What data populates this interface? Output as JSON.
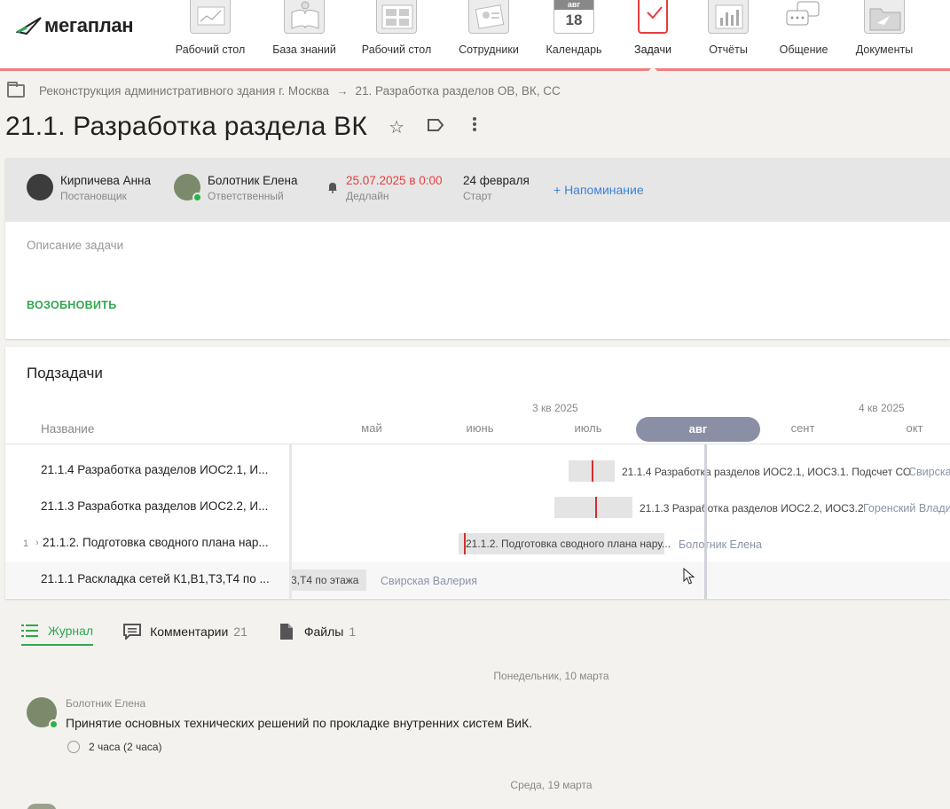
{
  "logo": {
    "text": "мегаплан"
  },
  "nav": [
    {
      "label": "Рабочий стол"
    },
    {
      "label": "База знаний"
    },
    {
      "label": "Рабочий стол"
    },
    {
      "label": "Сотрудники"
    },
    {
      "label": "Календарь",
      "month": "авг",
      "day": "18"
    },
    {
      "label": "Задачи"
    },
    {
      "label": "Отчёты"
    },
    {
      "label": "Общение"
    },
    {
      "label": "Документы"
    }
  ],
  "breadcrumb": {
    "parent": "Реконструкция административного здания г. Москва",
    "arrow": "→",
    "current": "21. Разработка разделов ОВ, ВК, СС"
  },
  "task": {
    "title": "21.1. Разработка раздела ВК",
    "setter": {
      "name": "Кирпичева Анна",
      "role": "Постановщик"
    },
    "responsible": {
      "name": "Болотник Елена",
      "role": "Ответственный"
    },
    "deadline": {
      "value": "25.07.2025 в 0:00",
      "label": "Дедлайн"
    },
    "start": {
      "value": "24 февраля",
      "label": "Старт"
    },
    "reminder": "+ Напоминание",
    "description_placeholder": "Описание задачи",
    "reopen": "ВОЗОБНОВИТЬ"
  },
  "subtasks": {
    "title": "Подзадачи",
    "column_name": "Название",
    "quarters": [
      "3 кв 2025",
      "4 кв 2025"
    ],
    "months": [
      "май",
      "июнь",
      "июль",
      "авг",
      "сент",
      "окт"
    ],
    "active_month": "авг",
    "rows": [
      {
        "name": "21.1.4 Разработка разделов ИОС2.1, И...",
        "bar_label": "21.1.4 Разработка разделов ИОС2.1, ИОС3.1. Подсчет СО",
        "owner": "Свирска"
      },
      {
        "name": "21.1.3 Разработка разделов ИОС2.2, И...",
        "bar_label": "21.1.3 Разработка разделов ИОС2.2, ИОС3.2",
        "owner": "Горенский Влади"
      },
      {
        "num": "1",
        "name": "21.1.2. Подготовка сводного плана нар...",
        "bar_label": "21.1.2. Подготовка сводного плана нару...",
        "owner": "Болотник Елена"
      },
      {
        "name": "21.1.1 Раскладка сетей К1,В1,Т3,Т4 по ...",
        "bar_label": "3,Т4 по этажа",
        "owner": "Свирская Валерия"
      }
    ]
  },
  "journal": {
    "tabs": [
      {
        "label": "Журнал",
        "count": ""
      },
      {
        "label": "Комментарии",
        "count": "21"
      },
      {
        "label": "Файлы",
        "count": "1"
      }
    ],
    "day1": "Понедельник, 10 марта",
    "entry": {
      "author": "Болотник Елена",
      "text": "Принятие основных технических решений по прокладке внутренних систем ВиК.",
      "time": "2 часа (2 часа)"
    },
    "day2": "Среда, 19 марта"
  },
  "colors": {
    "accent_green": "#2fa84f",
    "nav_red": "#f07d7d",
    "deadline_red": "#e53e3e",
    "link_blue": "#3d82d8"
  }
}
